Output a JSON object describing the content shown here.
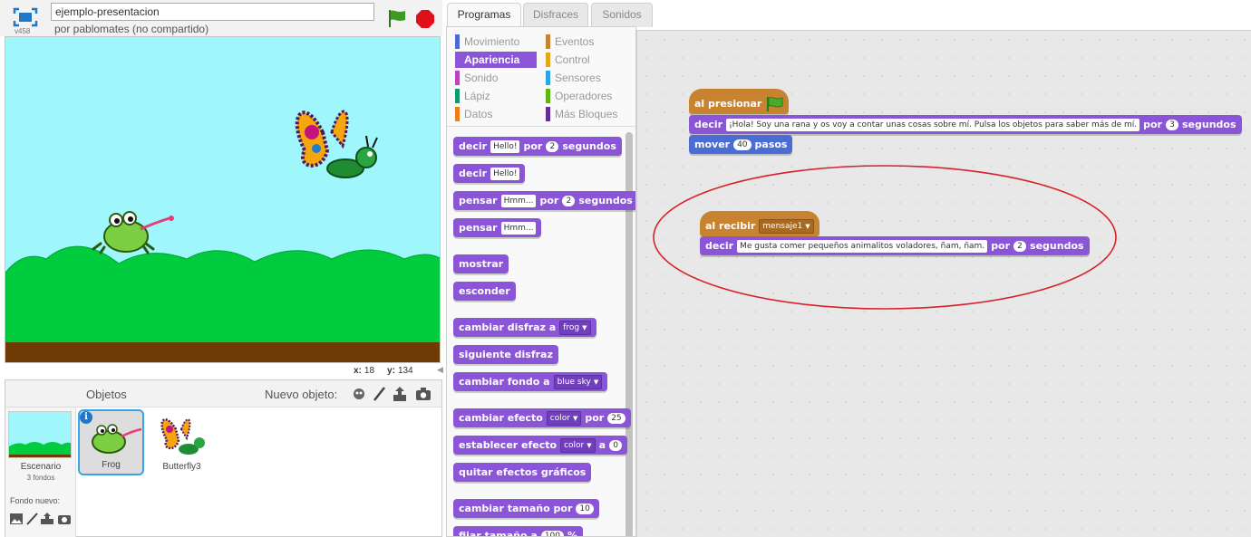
{
  "app": {
    "version": "v458",
    "project_title": "ejemplo-presentacion",
    "author_line": "por pablomates (no compartido)"
  },
  "stage": {
    "mouse_x": "18",
    "mouse_y": "134",
    "x_label": "x:",
    "y_label": "y:",
    "sky_color": "#9ff7fb",
    "hill_color": "#00cc3d",
    "ground_color": "#6e3a06"
  },
  "sprites_panel": {
    "title": "Objetos",
    "new_sprite_label": "Nuevo objeto:",
    "stage_item": {
      "name": "Escenario",
      "count": "3 fondos"
    },
    "new_backdrop_label": "Fondo nuevo:",
    "sprites": [
      {
        "name": "Frog",
        "selected": true,
        "info_label": "i"
      },
      {
        "name": "Butterfly3",
        "selected": false
      }
    ]
  },
  "tabs": [
    {
      "label": "Programas",
      "active": true
    },
    {
      "label": "Disfraces",
      "active": false
    },
    {
      "label": "Sonidos",
      "active": false
    }
  ],
  "categories": [
    {
      "label": "Movimiento",
      "color": "#4a6cd4"
    },
    {
      "label": "Eventos",
      "color": "#c88330"
    },
    {
      "label": "Apariencia",
      "color": "#8a55d7",
      "active": true
    },
    {
      "label": "Control",
      "color": "#e1a91a"
    },
    {
      "label": "Sonido",
      "color": "#bb42c3"
    },
    {
      "label": "Sensores",
      "color": "#2ca5e2"
    },
    {
      "label": "Lápiz",
      "color": "#0e9a6c"
    },
    {
      "label": "Operadores",
      "color": "#5cb712"
    },
    {
      "label": "Datos",
      "color": "#ee7d16"
    },
    {
      "label": "Más Bloques",
      "color": "#632d99"
    }
  ],
  "palette_blocks": {
    "b1": {
      "w1": "decir",
      "slot": "Hello!",
      "w2": "por",
      "num": "2",
      "w3": "segundos"
    },
    "b2": {
      "w1": "decir",
      "slot": "Hello!"
    },
    "b3": {
      "w1": "pensar",
      "slot": "Hmm...",
      "w2": "por",
      "num": "2",
      "w3": "segundos"
    },
    "b4": {
      "w1": "pensar",
      "slot": "Hmm..."
    },
    "b5": {
      "w1": "mostrar"
    },
    "b6": {
      "w1": "esconder"
    },
    "b7": {
      "w1": "cambiar disfraz a",
      "drop": "frog"
    },
    "b8": {
      "w1": "siguiente disfraz"
    },
    "b9": {
      "w1": "cambiar fondo a",
      "drop": "blue sky"
    },
    "b10": {
      "w1": "cambiar efecto",
      "drop": "color",
      "w2": "por",
      "num": "25"
    },
    "b11": {
      "w1": "establecer efecto",
      "drop": "color",
      "w2": "a",
      "num": "0"
    },
    "b12": {
      "w1": "quitar efectos gráficos"
    },
    "b13": {
      "w1": "cambiar tamaño por",
      "num": "10"
    },
    "b14": {
      "w1": "fijar tamaño a",
      "num": "100",
      "w2": "%"
    }
  },
  "scripts": {
    "script1": {
      "hat": "al presionar",
      "say": {
        "w1": "decir",
        "text": "¡Hola! Soy una rana y os voy a contar unas cosas sobre mí. Pulsa los objetos para saber más de mí.",
        "w2": "por",
        "num": "3",
        "w3": "segundos"
      },
      "move": {
        "w1": "mover",
        "num": "40",
        "w2": "pasos"
      }
    },
    "script2": {
      "hat": "al recibir",
      "message": "mensaje1",
      "say": {
        "w1": "decir",
        "text": "Me gusta comer pequeños animalitos voladores, ñam, ñam.",
        "w2": "por",
        "num": "2",
        "w3": "segundos"
      }
    },
    "highlight_color": "#d9202a"
  }
}
